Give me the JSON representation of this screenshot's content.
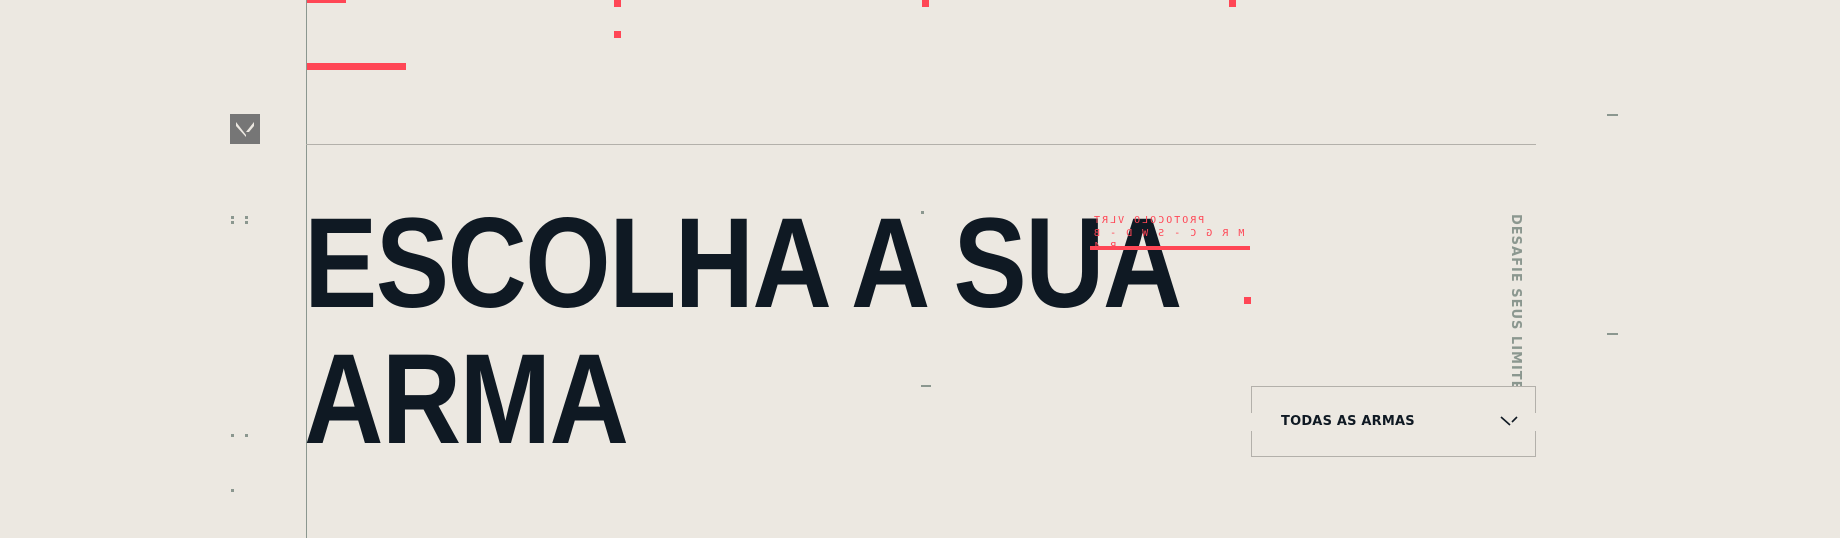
{
  "headline": {
    "line1": "ESCOLHA A SUA",
    "line2": "ARMA"
  },
  "protocol": {
    "line1": "PROTOCOLO VLRT",
    "line2": "M R G C - S W D - B R 4"
  },
  "side_tag": "DESAFIE SEUS LIMITES",
  "filter": {
    "selected": "TODAS AS ARMAS"
  },
  "icons": {
    "logo": "valorant-logo-icon",
    "dropdown": "chevron-down-icon"
  },
  "colors": {
    "background": "#ece8e1",
    "accent": "#ff4655",
    "text": "#0f1923",
    "muted": "#8b978f"
  }
}
